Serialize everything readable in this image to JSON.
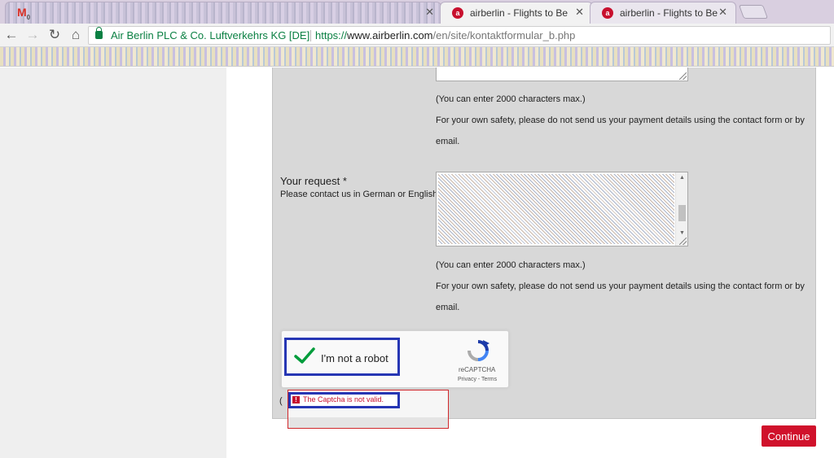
{
  "browser": {
    "tabs": [
      {
        "title": "",
        "favicon": "gmail-icon",
        "badge": "0"
      },
      {
        "title": "airberlin - Flights to Berl",
        "favicon": "airberlin-icon",
        "active": true
      },
      {
        "title": "airberlin - Flights to Berl",
        "favicon": "airberlin-icon"
      }
    ],
    "security_label": "Air Berlin PLC & Co. Luftverkehrs KG [DE]",
    "url": {
      "scheme": "https://",
      "host": "www.airberlin.com",
      "path": "/en/site/kontaktformular_b.php"
    }
  },
  "form": {
    "top_note_max": "(You can enter 2000 characters max.)",
    "top_note_safety_1": "For your own safety, please do not send us your payment details using the contact form or by",
    "top_note_safety_2": "email.",
    "request_label": "Your request *",
    "request_sublabel": "Please contact us in German or English",
    "bottom_note_max": "(You can enter 2000 characters max.)",
    "bottom_note_safety_1": "For your own safety, please do not send us your payment details using the contact form or by",
    "bottom_note_safety_2": "email."
  },
  "recaptcha": {
    "label": "I'm not a robot",
    "brand": "reCAPTCHA",
    "links": "Privacy - Terms",
    "check_color": "#009c3b"
  },
  "error": {
    "paren": "(",
    "icon": "!",
    "message": "The Captcha is not valid."
  },
  "actions": {
    "continue_label": "Continue"
  },
  "colors": {
    "brand_red": "#d0112b",
    "highlight_blue": "#2636b4",
    "panel_gray": "#d8d8d8"
  }
}
